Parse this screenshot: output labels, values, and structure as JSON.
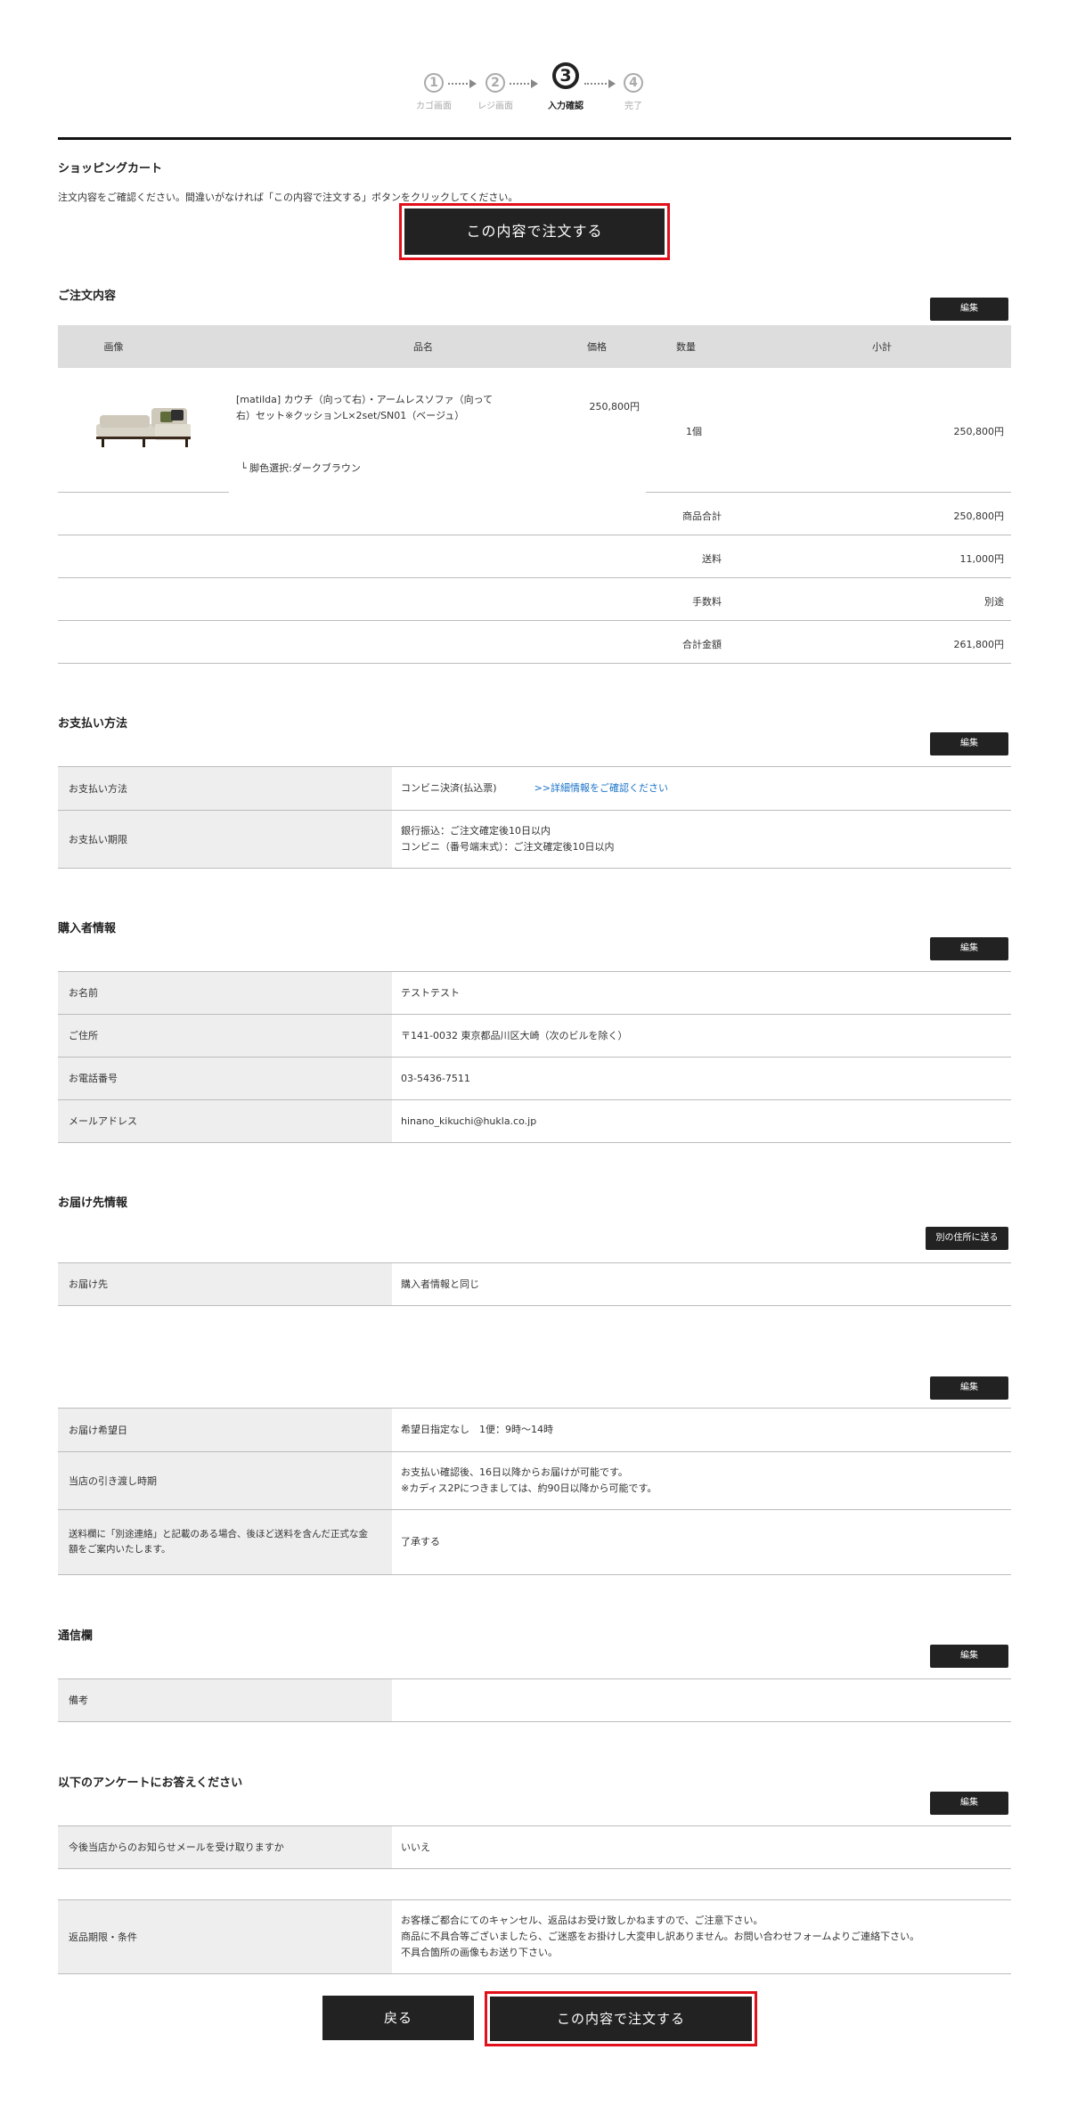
{
  "stepper": {
    "steps": [
      {
        "num": "1",
        "label": "カゴ画面"
      },
      {
        "num": "2",
        "label": "レジ画面"
      },
      {
        "num": "3",
        "label": "入力確認"
      },
      {
        "num": "4",
        "label": "完了"
      }
    ],
    "active_step": 3
  },
  "cart": {
    "title": "ショッピングカート",
    "instruction": "注文内容をご確認ください。間違いがなければ「この内容で注文する」ボタンをクリックしてください。",
    "order_button_label": "この内容で注文する"
  },
  "order": {
    "title": "ご注文内容",
    "edit_label": "編集",
    "columns": [
      "画像",
      "品名",
      "価格",
      "数量",
      "小計"
    ],
    "item": {
      "name_line1": "[matilda] カウチ（向って右）・アームレスソファ（向って",
      "name_line2": "右）セット※クッションL×2set/SN01（ベージュ）",
      "option": "└ 脚色選択:ダークブラウン",
      "price": "250,800円",
      "quantity": "1個",
      "subtotal": "250,800円",
      "image_icon": "sofa-product-image"
    },
    "summary": [
      {
        "label": "商品合計",
        "value": "250,800円"
      },
      {
        "label": "送料",
        "value": "11,000円"
      },
      {
        "label": "手数料",
        "value": "別途"
      },
      {
        "label": "合計金額",
        "value": "261,800円"
      }
    ]
  },
  "payment": {
    "title": "お支払い方法",
    "edit_label": "編集",
    "method_label": "お支払い方法",
    "method_value": "コンビニ決済(払込票)",
    "details_link": ">>詳細情報をご確認ください",
    "deadline_label": "お支払い期限",
    "deadline_line1": "銀行振込：ご注文確定後10日以内",
    "deadline_line2": "コンビニ（番号端末式）：ご注文確定後10日以内"
  },
  "buyer": {
    "title": "購入者情報",
    "edit_label": "編集",
    "rows": [
      {
        "label": "お名前",
        "value": "テストテスト"
      },
      {
        "label": "ご住所",
        "value": "〒141-0032 東京都品川区大崎（次のビルを除く）"
      },
      {
        "label": "お電話番号",
        "value": "03-5436-7511"
      },
      {
        "label": "メールアドレス",
        "value": "hinano_kikuchi@hukla.co.jp"
      }
    ]
  },
  "shipping": {
    "title": "お届け先情報",
    "other_address_label": "別の住所に送る",
    "dest_label": "お届け先",
    "dest_value": "購入者情報と同じ",
    "edit_label": "編集",
    "date_label": "お届け希望日",
    "date_value": "希望日指定なし　1便：9時～14時",
    "handover_label": "当店の引き渡し時期",
    "handover_line1": "お支払い確認後、16日以降からお届けが可能です。",
    "handover_line2": "※カディス2Pにつきましては、約90日以降から可能です。",
    "fee_label_line1": "送料欄に「別途連絡」と記載のある場合、後ほど送料を含んだ正式な金",
    "fee_label_line2": "額をご案内いたします。",
    "fee_value": "了承する"
  },
  "comm": {
    "title": "通信欄",
    "edit_label": "編集",
    "remarks_label": "備考",
    "remarks_value": ""
  },
  "survey": {
    "title": "以下のアンケートにお答えください",
    "edit_label": "編集",
    "newsletter_label": "今後当店からのお知らせメールを受け取りますか",
    "newsletter_value": "いいえ",
    "return_label": "返品期限・条件",
    "return_line1": "お客様ご都合にてのキャンセル、返品はお受け致しかねますので、ご注意下さい。",
    "return_line2": "商品に不具合等ございましたら、ご迷惑をお掛けし大変申し訳ありません。お問い合わせフォームよりご連絡下さい。",
    "return_line3": "不具合箇所の画像もお送り下さい。"
  },
  "footer": {
    "back_label": "戻る",
    "order_button_label": "この内容で注文する"
  },
  "colors": {
    "dark_button": "#222222",
    "highlight_border": "#e1101a",
    "label_cell": "#eeeeee",
    "table_header": "#dddddd",
    "link": "#1a73c7"
  }
}
